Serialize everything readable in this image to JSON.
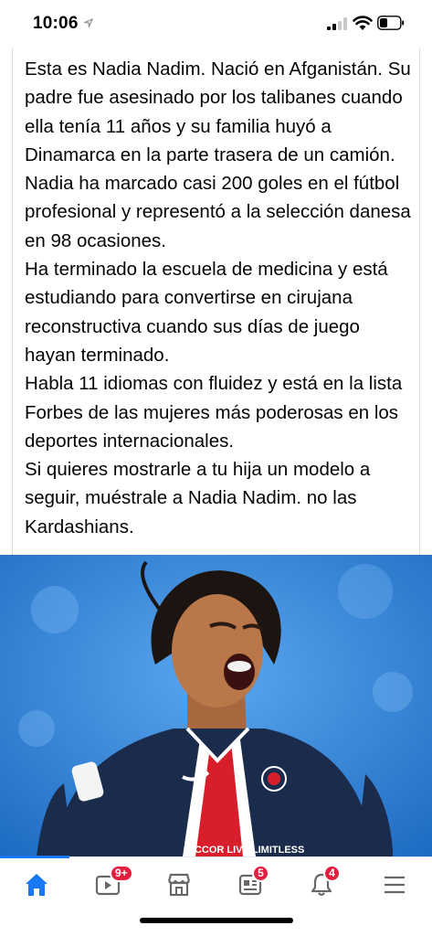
{
  "status_bar": {
    "time": "10:06",
    "icons": [
      "location-arrow-icon",
      "signal-icon",
      "wifi-icon",
      "battery-icon"
    ]
  },
  "post": {
    "paragraphs": [
      "Esta es Nadia Nadim. Nació en Afganistán. Su padre fue asesinado por los talibanes cuando ella tenía 11 años y su familia huyó a Dinamarca en la parte trasera de un camión.",
      "Nadia ha marcado casi 200 goles en el fútbol profesional y representó a la selección danesa en 98 ocasiones.",
      "Ha terminado la escuela de medicina y está estudiando para convertirse en cirujana reconstructiva cuando sus días de juego hayan terminado.",
      "Habla 11 idiomas con fluidez y está en la lista Forbes de las mujeres más poderosas en los deportes internacionales.",
      "Si quieres mostrarle a tu hija un modelo a seguir, muéstrale a Nadia Nadim. no las Kardashians."
    ],
    "photo": {
      "jersey_sponsor": "ACCOR LIVE LIMITLESS",
      "colors": {
        "background": "#2f7fd6",
        "jersey": "#1a2b4c",
        "stripe": "#d81e2a"
      }
    }
  },
  "tab_bar": {
    "tabs": [
      {
        "name": "home",
        "icon": "home-icon",
        "active": true,
        "badge": ""
      },
      {
        "name": "watch",
        "icon": "video-icon",
        "active": false,
        "badge": "9+"
      },
      {
        "name": "marketplace",
        "icon": "marketplace-icon",
        "active": false,
        "badge": ""
      },
      {
        "name": "news",
        "icon": "news-icon",
        "active": false,
        "badge": "5"
      },
      {
        "name": "notifications",
        "icon": "bell-icon",
        "active": false,
        "badge": "4"
      },
      {
        "name": "menu",
        "icon": "hamburger-menu-icon",
        "active": false,
        "badge": ""
      }
    ],
    "accent": "#1877f2",
    "badge_color": "#e41e3f"
  }
}
